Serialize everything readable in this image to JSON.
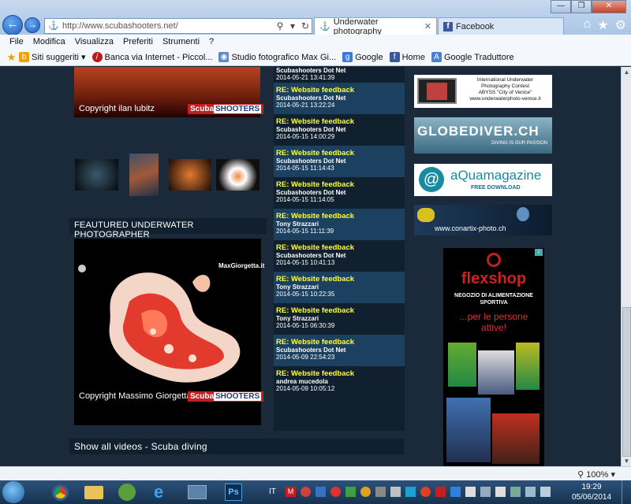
{
  "browser": {
    "url": "http://www.scubashooters.net/",
    "tabs": [
      {
        "label": "Underwater photography"
      },
      {
        "label": "Facebook"
      }
    ],
    "menu": [
      "File",
      "Modifica",
      "Visualizza",
      "Preferiti",
      "Strumenti",
      "?"
    ],
    "favorites": [
      {
        "label": "Siti suggeriti ▾",
        "icon": "star-icon"
      },
      {
        "label": "Banca via Internet - Piccol...",
        "icon": "bank-icon"
      },
      {
        "label": "Studio fotografico Max Gi...",
        "icon": "globe-icon"
      },
      {
        "label": "Google",
        "icon": "google-icon"
      },
      {
        "label": "Home",
        "icon": "facebook-icon"
      },
      {
        "label": "Google Traduttore",
        "icon": "translate-icon"
      }
    ]
  },
  "left": {
    "top_photo_copyright": "Copyright ilan lubitz",
    "featured_heading": "FEAUTURED UNDERWATER PHOTOGRAPHER",
    "featured_copyright": "Copyright Massimo Giorgetta",
    "featured_watermark": "MaxGiorgetta.it",
    "logo_text_a": "Scuba",
    "logo_text_b": "SHOOTERS",
    "videos_link": "Show all videos - Scuba diving"
  },
  "posts": [
    {
      "title": "",
      "author": "Scubashooters Dot Net",
      "date": "2014-05-21 13:41:39"
    },
    {
      "title": "RE: Website feedback",
      "author": "Scubashooters Dot Net",
      "date": "2014-05-21 13:22:24"
    },
    {
      "title": "RE: Website feedback",
      "author": "Scubashooters Dot Net",
      "date": "2014-05-15 14:00:29"
    },
    {
      "title": "RE: Website feedback",
      "author": "Scubashooters Dot Net",
      "date": "2014-05-15 11:14:43"
    },
    {
      "title": "RE: Website feedback",
      "author": "Scubashooters Dot Net",
      "date": "2014-05-15 11:14:05"
    },
    {
      "title": "RE: Website feedback",
      "author": "Tony Strazzari",
      "date": "2014-05-15 11:11:39"
    },
    {
      "title": "RE: Website feedback",
      "author": "Scubashooters Dot Net",
      "date": "2014-05-15 10:41:13"
    },
    {
      "title": "RE: Website feedback",
      "author": "Tony Strazzari",
      "date": "2014-05-15 10:22:35"
    },
    {
      "title": "RE: Website feedback",
      "author": "Tony Strazzari",
      "date": "2014-05-15 06:30:39"
    },
    {
      "title": "RE: Website feedback",
      "author": "Scubashooters Dot Net",
      "date": "2014-05-09 22:54:23"
    },
    {
      "title": "RE: Website feedback",
      "author": "andrea mucedola",
      "date": "2014-05-09 10:05:12"
    }
  ],
  "banners": {
    "contest_line1": "International Underwater",
    "contest_line2": "Photography Contest",
    "contest_line3": "ABYSS \"City of Venice\"",
    "contest_line4": "www.underwaterphoto-venice.it",
    "globe_title": "GLOBEDIVER.CH",
    "globe_tag": "DIVING IS OUR PASSION",
    "aqua_title": "aQuamagazine",
    "aqua_sub": "FREE DOWNLOAD",
    "conartix": "www.conartix-photo.ch",
    "flex_title": "flexshop",
    "flex_sub": "NEGOZIO DI ALIMENTAZIONE SPORTIVA",
    "flex_slogan": "...per le persone attive!"
  },
  "statusbar": {
    "zoom": "100%"
  },
  "taskbar": {
    "lang": "IT",
    "time": "19:29",
    "date": "05/06/2014",
    "apps": [
      "start-orb-icon",
      "chrome-icon",
      "folder-icon",
      "ie-icon",
      "paint-icon",
      "photoshop-icon"
    ]
  },
  "colors": {
    "page_bg": "#1b2a3a",
    "post_title": "#ffff33",
    "post_alt_bg": "#1b4060",
    "taskbar": "#1f3b5c"
  }
}
